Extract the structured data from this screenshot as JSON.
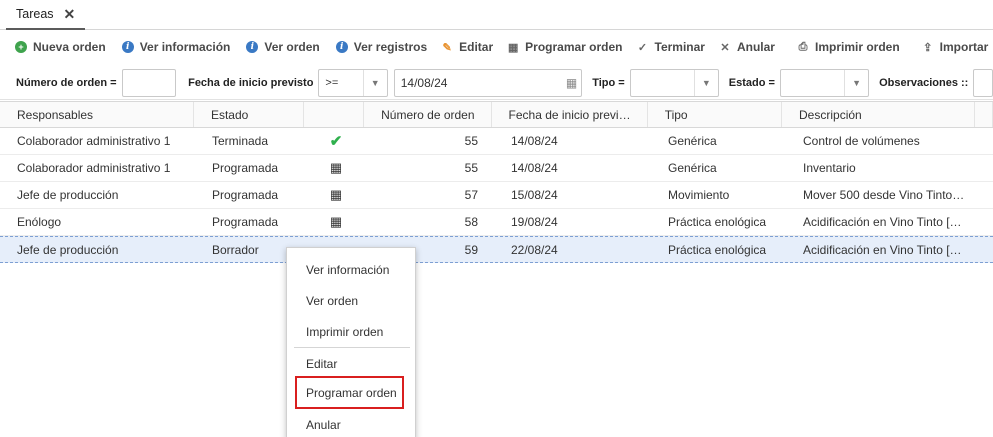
{
  "tabs": [
    {
      "label": "Tareas",
      "close": "✕"
    }
  ],
  "toolbar": {
    "new_order": "Nueva orden",
    "view_info": "Ver información",
    "view_order": "Ver orden",
    "view_records": "Ver registros",
    "edit": "Editar",
    "schedule_order": "Programar orden",
    "finish": "Terminar",
    "cancel": "Anular",
    "print_order": "Imprimir orden",
    "import": "Importar"
  },
  "filters": {
    "order_number_label": "Número de orden =",
    "order_number_value": "",
    "start_date_label": "Fecha de inicio previsto",
    "start_date_operator": ">=",
    "start_date_value": "14/08/24",
    "type_label": "Tipo =",
    "type_value": "",
    "status_label": "Estado =",
    "status_value": "",
    "observations_label": "Observaciones ::"
  },
  "grid": {
    "columns": [
      "Responsables",
      "Estado",
      "",
      "Número de orden",
      "Fecha de inicio previ…",
      "Tipo",
      "Descripción"
    ],
    "rows": [
      {
        "responsable": "Colaborador administrativo 1",
        "estado": "Terminada",
        "icon": "✔",
        "numero": "55",
        "fecha": "14/08/24",
        "tipo": "Genérica",
        "descripcion": "Control de volúmenes"
      },
      {
        "responsable": "Colaborador administrativo 1",
        "estado": "Programada",
        "icon": "📅",
        "numero": "55",
        "fecha": "14/08/24",
        "tipo": "Genérica",
        "descripcion": "Inventario"
      },
      {
        "responsable": "Jefe de producción",
        "estado": "Programada",
        "icon": "📅",
        "numero": "57",
        "fecha": "15/08/24",
        "tipo": "Movimiento",
        "descripcion": "Mover 500 desde Vino Tinto…"
      },
      {
        "responsable": "Enólogo",
        "estado": "Programada",
        "icon": "📅",
        "numero": "58",
        "fecha": "19/08/24",
        "tipo": "Práctica enológica",
        "descripcion": "Acidificación en Vino Tinto […"
      },
      {
        "responsable": "Jefe de producción",
        "estado": "Borrador",
        "icon": "",
        "numero": "59",
        "fecha": "22/08/24",
        "tipo": "Práctica enológica",
        "descripcion": "Acidificación en Vino Tinto […"
      }
    ]
  },
  "context_menu": {
    "items": [
      "Ver información",
      "Ver orden",
      "Imprimir orden",
      "Editar",
      "Programar orden",
      "Anular"
    ]
  },
  "colors": {
    "accent_green": "#3fa34d",
    "accent_blue": "#3a79c4",
    "highlight_red": "#d91f1f",
    "selected_row": "#e6eefa"
  }
}
